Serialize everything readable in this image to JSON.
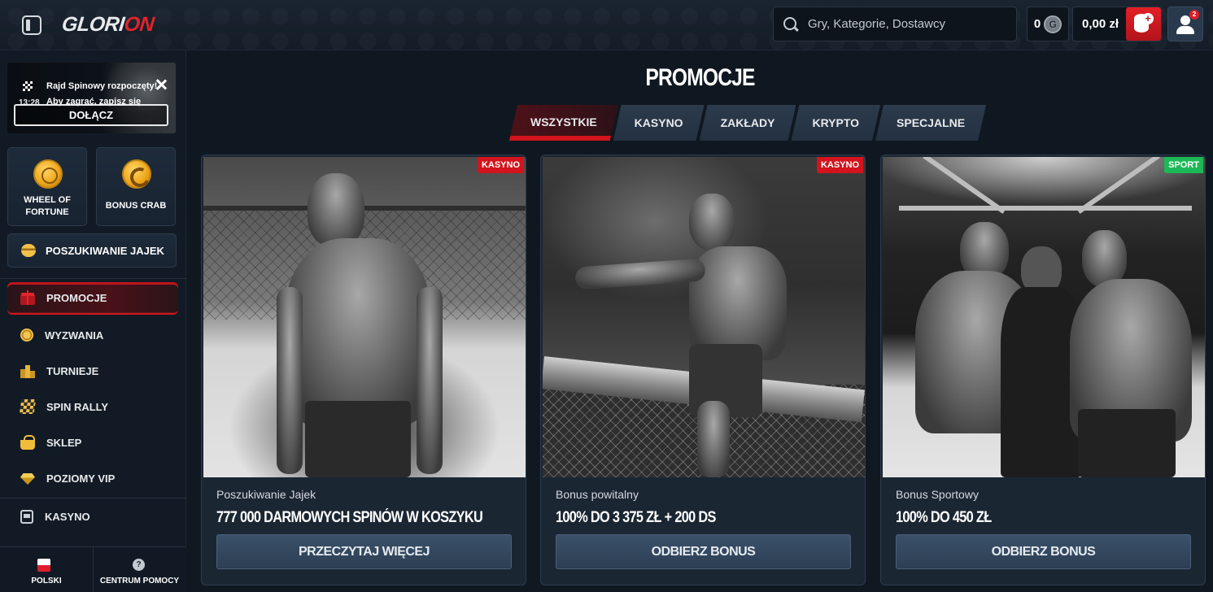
{
  "header": {
    "logo_left": "GLORI",
    "logo_right": "ON",
    "search_placeholder": "Gry, Kategorie, Dostawcy",
    "coins": "0",
    "coins_icon": "G",
    "balance": "0,00 zł",
    "deposit_plus": "+",
    "user_badge": "2"
  },
  "sidebar": {
    "notification": {
      "title": "Rajd Spinowy rozpoczęty!",
      "subtitle": "Aby zagrać, zapisz się",
      "time": "13:28",
      "join_label": "DOŁĄCZ"
    },
    "tiles": [
      {
        "label_line1": "WHEEL OF",
        "label_line2": "FORTUNE",
        "icon": "wheel-coin-icon"
      },
      {
        "label_line1": "BONUS CRAB",
        "label_line2": "",
        "icon": "crab-coin-icon"
      }
    ],
    "egg_hunt_label": "POSZUKIWANIE JAJEK",
    "nav": [
      {
        "label": "PROMOCJE",
        "icon": "gift-icon",
        "active": true
      },
      {
        "label": "WYZWANIA",
        "icon": "medal-icon"
      },
      {
        "label": "TURNIEJE",
        "icon": "podium-icon"
      },
      {
        "label": "SPIN RALLY",
        "icon": "checkered-flag-icon"
      },
      {
        "label": "SKLEP",
        "icon": "shopping-bag-icon"
      },
      {
        "label": "POZIOMY VIP",
        "icon": "diamond-icon"
      },
      {
        "label": "KASYNO",
        "icon": "slot-machine-icon"
      }
    ],
    "footer": {
      "language": "POLSKI",
      "help": "CENTRUM POMOCY",
      "help_icon": "?"
    }
  },
  "main": {
    "title": "PROMOCJE",
    "tabs": [
      {
        "label": "WSZYSTKIE",
        "active": true
      },
      {
        "label": "KASYNO"
      },
      {
        "label": "ZAKŁADY"
      },
      {
        "label": "KRYPTO"
      },
      {
        "label": "SPECJALNE"
      }
    ],
    "cards": [
      {
        "tag": "KASYNO",
        "tag_color": "#d3141d",
        "subtitle": "Poszukiwanie Jajek",
        "headline": "777 000 DARMOWYCH SPINÓW W KOSZYKU",
        "cta": "PRZECZYTAJ WIĘCEJ"
      },
      {
        "tag": "KASYNO",
        "tag_color": "#d3141d",
        "subtitle": "Bonus powitalny",
        "headline": "100% DO 3 375 ZŁ + 200 DS",
        "cta": "ODBIERZ BONUS"
      },
      {
        "tag": "SPORT",
        "tag_color": "#1db856",
        "subtitle": "Bonus Sportowy",
        "headline": "100% DO 450 ZŁ",
        "cta": "ODBIERZ BONUS"
      }
    ]
  },
  "colors": {
    "accent_red": "#d3141d",
    "sport_green": "#1db856",
    "background": "#0f1822"
  }
}
